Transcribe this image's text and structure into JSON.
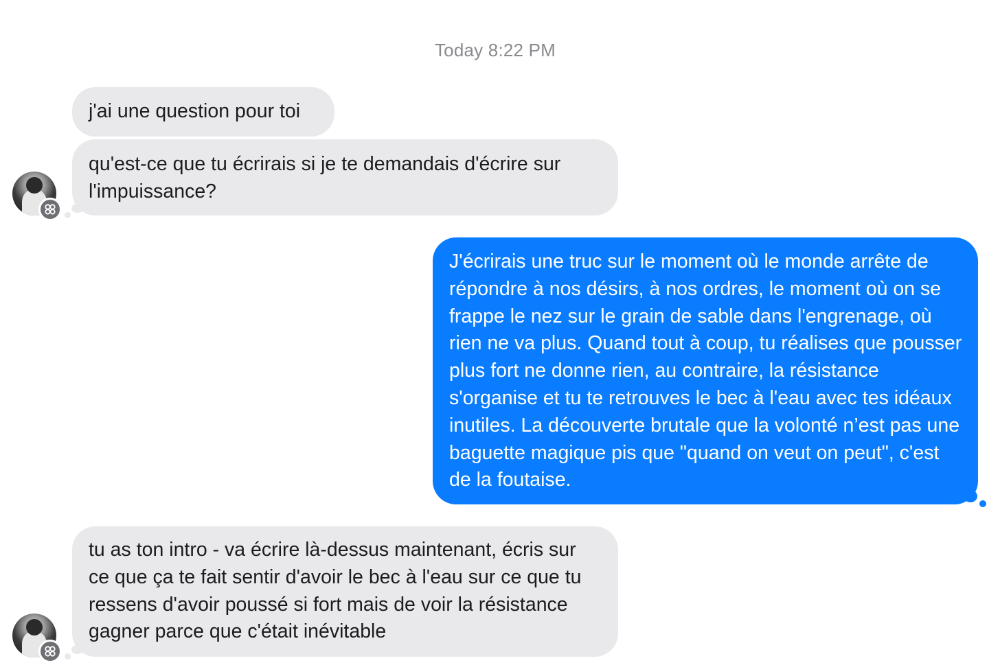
{
  "conversation": {
    "timestamp": "Today 8:22 PM",
    "messages": [
      {
        "sender": "other",
        "text": "j'ai une question pour toi"
      },
      {
        "sender": "other",
        "text": "qu'est-ce que tu écrirais si je te demandais d'écrire sur l'impuissance?"
      },
      {
        "sender": "me",
        "text": "J'écrirais une truc sur le moment où le monde arrête de répondre à nos désirs, à nos ordres, le moment où on se frappe le nez sur le grain de sable dans l'engrenage, où rien ne va plus. Quand tout à coup, tu réalises que pousser plus fort ne donne rien, au contraire, la résistance s'organise et tu te retrouves le bec à l'eau avec tes idéaux inutiles. La découverte brutale que la volonté n’est pas une baguette magique pis que \"quand on veut on peut\", c'est de la foutaise."
      },
      {
        "sender": "other",
        "text": "tu as ton intro - va écrire là-dessus maintenant, écris sur ce que ça te fait sentir d'avoir le bec à l'eau sur ce que tu ressens d'avoir poussé si fort mais de voir la résistance gagner parce que c'était inévitable"
      }
    ]
  },
  "colors": {
    "incoming_bubble": "#e9e9eb",
    "outgoing_bubble": "#0a7cff",
    "timestamp_text": "#8a8a8e"
  },
  "icons": {
    "avatar_badge": "flower-icon"
  }
}
